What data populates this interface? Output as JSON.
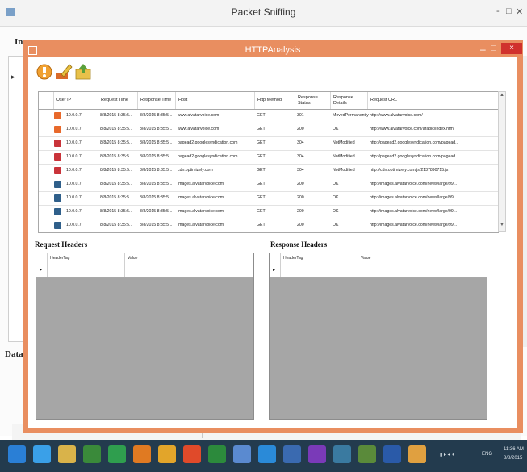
{
  "background_window": {
    "title": "Packet Sniffing",
    "min": "-",
    "max": "□",
    "close": "✕",
    "label_interfaces": "Inte",
    "label_data": "Data"
  },
  "analysis_window": {
    "title": "HTTPAnalysis",
    "min": "–",
    "max": "□",
    "close": "×",
    "toolbar": [
      "capture-icon",
      "edit-icon",
      "save-icon"
    ],
    "columns": [
      "User IP",
      "Request Time",
      "Response Time",
      "Host",
      "Http Method",
      "Response Status",
      "Response Details",
      "Request URL"
    ],
    "rows": [
      {
        "icon": "orange",
        "ip": "10.0.0.7",
        "req": "8/8/2015 8:35:5...",
        "resp": "8/8/2015 8:35:5...",
        "host": "www.alvatarvoice.com",
        "method": "GET",
        "status": "301",
        "details": "MovedPermanently",
        "url": "http://www.alvatarvoice.com/"
      },
      {
        "icon": "orange",
        "ip": "10.0.0.7",
        "req": "8/8/2015 8:35:5...",
        "resp": "8/8/2015 8:35:5...",
        "host": "www.alvatarvoice.com",
        "method": "GET",
        "status": "200",
        "details": "OK",
        "url": "http://www.alvatarvoice.com/arabic/index.html"
      },
      {
        "icon": "red",
        "ip": "10.0.0.7",
        "req": "8/8/2015 8:35:5...",
        "resp": "8/8/2015 8:35:5...",
        "host": "pagead2.googlesyndication.com",
        "method": "GET",
        "status": "304",
        "details": "NotModified",
        "url": "http://pagead2.googlesyndication.com/pagead..."
      },
      {
        "icon": "red",
        "ip": "10.0.0.7",
        "req": "8/8/2015 8:35:5...",
        "resp": "8/8/2015 8:35:5...",
        "host": "pagead2.googlesyndication.com",
        "method": "GET",
        "status": "304",
        "details": "NotModified",
        "url": "http://pagead2.googlesyndication.com/pagead..."
      },
      {
        "icon": "red",
        "ip": "10.0.0.7",
        "req": "8/8/2015 8:35:5...",
        "resp": "8/8/2015 8:35:5...",
        "host": "cdn.optimizely.com",
        "method": "GET",
        "status": "304",
        "details": "NotModified",
        "url": "http://cdn.optimizely.com/js/2137890715.js"
      },
      {
        "icon": "blue",
        "ip": "10.0.0.7",
        "req": "8/8/2015 8:35:5...",
        "resp": "8/8/2015 8:35:5...",
        "host": "images.alvatarvoice.com",
        "method": "GET",
        "status": "200",
        "details": "OK",
        "url": "http://images.alvatarvoice.com/news/large/99..."
      },
      {
        "icon": "blue",
        "ip": "10.0.0.7",
        "req": "8/8/2015 8:35:5...",
        "resp": "8/8/2015 8:35:5...",
        "host": "images.alvatarvoice.com",
        "method": "GET",
        "status": "200",
        "details": "OK",
        "url": "http://images.alvatarvoice.com/news/large/99..."
      },
      {
        "icon": "blue",
        "ip": "10.0.0.7",
        "req": "8/8/2015 8:35:5...",
        "resp": "8/8/2015 8:35:5...",
        "host": "images.alvatarvoice.com",
        "method": "GET",
        "status": "200",
        "details": "OK",
        "url": "http://images.alvatarvoice.com/news/large/99..."
      },
      {
        "icon": "blue",
        "ip": "10.0.0.7",
        "req": "8/8/2015 8:35:5...",
        "resp": "8/8/2015 8:35:5...",
        "host": "images.alvatarvoice.com",
        "method": "GET",
        "status": "200",
        "details": "OK",
        "url": "http://images.alvatarvoice.com/news/large/99..."
      }
    ],
    "request_headers": {
      "label": "Request Headers",
      "col_tag": "HeaderTag",
      "col_value": "Value",
      "row_marker": "▸"
    },
    "response_headers": {
      "label": "Response Headers",
      "col_tag": "HeaderTag",
      "col_value": "Value",
      "row_marker": "▸"
    }
  },
  "taskbar": {
    "tray_lang": "ENG",
    "tray_time": "11:36 AM",
    "tray_date": "8/8/2015",
    "icons": [
      "start-icon",
      "ie-icon",
      "explorer-icon",
      "media-icon",
      "store-icon",
      "java-icon",
      "firefox-icon",
      "chrome-icon",
      "vs-icon",
      "app-icon-1",
      "app-icon-2",
      "app-icon-3",
      "visual-studio-icon",
      "paint-icon",
      "app-icon-4",
      "word-icon",
      "app-icon-5"
    ]
  },
  "colors": {
    "analysis_frame": "#e98e60",
    "close_button": "#d0312d",
    "taskbar": "#233b4e",
    "icon_orange": "#e8692b",
    "icon_red": "#c9333a",
    "icon_blue": "#2f5f8a"
  }
}
